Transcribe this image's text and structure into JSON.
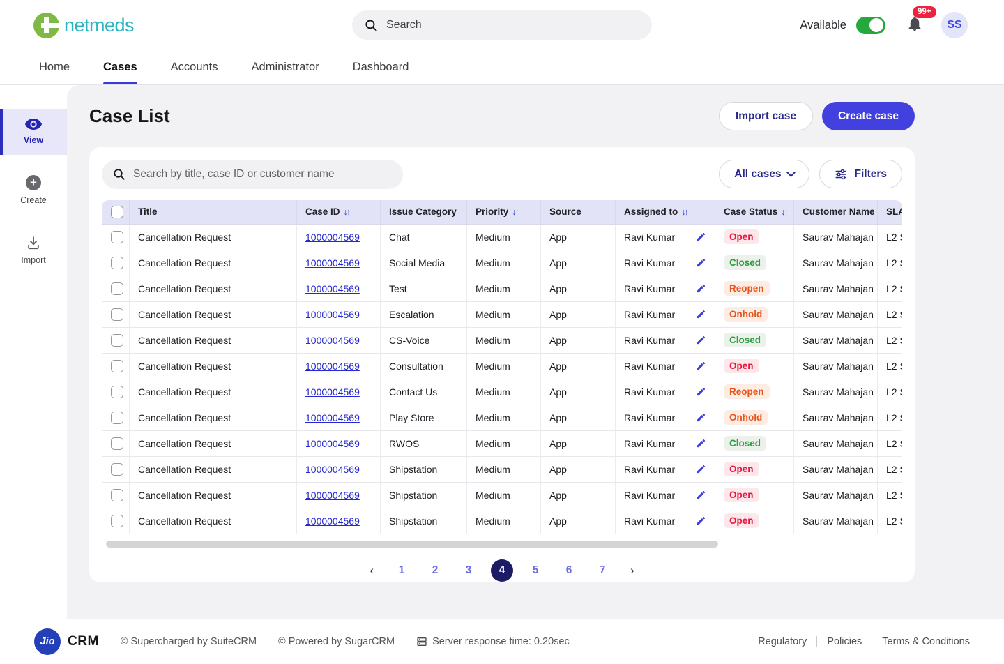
{
  "header": {
    "brand": "netmeds",
    "search_placeholder": "Search",
    "availability_label": "Available",
    "availability_on": true,
    "notification_count": "99+",
    "avatar_initials": "SS"
  },
  "nav": {
    "tabs": [
      {
        "label": "Home",
        "active": false
      },
      {
        "label": "Cases",
        "active": true
      },
      {
        "label": "Accounts",
        "active": false
      },
      {
        "label": "Administrator",
        "active": false
      },
      {
        "label": "Dashboard",
        "active": false
      }
    ]
  },
  "sidebar": {
    "items": [
      {
        "label": "View",
        "active": true
      },
      {
        "label": "Create",
        "active": false
      },
      {
        "label": "Import",
        "active": false
      }
    ]
  },
  "main": {
    "title": "Case List",
    "import_button": "Import case",
    "create_button": "Create case",
    "search_placeholder": "Search by title, case ID or customer name",
    "all_cases_button": "All cases",
    "filters_button": "Filters"
  },
  "table": {
    "columns": [
      {
        "label": "Title",
        "sortable": false
      },
      {
        "label": "Case ID",
        "sortable": true
      },
      {
        "label": "Issue Category",
        "sortable": false
      },
      {
        "label": "Priority",
        "sortable": true
      },
      {
        "label": "Source",
        "sortable": false
      },
      {
        "label": "Assigned to",
        "sortable": true
      },
      {
        "label": "Case Status",
        "sortable": true
      },
      {
        "label": "Customer Name",
        "sortable": false
      },
      {
        "label": "SLA",
        "sortable": false
      }
    ],
    "rows": [
      {
        "title": "Cancellation Request",
        "case_id": "1000004569",
        "issue_category": "Chat",
        "priority": "Medium",
        "source": "App",
        "assigned_to": "Ravi Kumar",
        "status": "Open",
        "customer": "Saurav Mahajan",
        "sla": "L2 S"
      },
      {
        "title": "Cancellation Request",
        "case_id": "1000004569",
        "issue_category": "Social Media",
        "priority": "Medium",
        "source": "App",
        "assigned_to": "Ravi Kumar",
        "status": "Closed",
        "customer": "Saurav Mahajan",
        "sla": "L2 S"
      },
      {
        "title": "Cancellation Request",
        "case_id": "1000004569",
        "issue_category": "Test",
        "priority": "Medium",
        "source": "App",
        "assigned_to": "Ravi Kumar",
        "status": "Reopen",
        "customer": "Saurav Mahajan",
        "sla": "L2 S"
      },
      {
        "title": "Cancellation Request",
        "case_id": "1000004569",
        "issue_category": "Escalation",
        "priority": "Medium",
        "source": "App",
        "assigned_to": "Ravi Kumar",
        "status": "Onhold",
        "customer": "Saurav Mahajan",
        "sla": "L2 S"
      },
      {
        "title": "Cancellation Request",
        "case_id": "1000004569",
        "issue_category": "CS-Voice",
        "priority": "Medium",
        "source": "App",
        "assigned_to": "Ravi Kumar",
        "status": "Closed",
        "customer": "Saurav Mahajan",
        "sla": "L2 S"
      },
      {
        "title": "Cancellation Request",
        "case_id": "1000004569",
        "issue_category": "Consultation",
        "priority": "Medium",
        "source": "App",
        "assigned_to": "Ravi Kumar",
        "status": "Open",
        "customer": "Saurav Mahajan",
        "sla": "L2 S"
      },
      {
        "title": "Cancellation Request",
        "case_id": "1000004569",
        "issue_category": "Contact Us",
        "priority": "Medium",
        "source": "App",
        "assigned_to": "Ravi Kumar",
        "status": "Reopen",
        "customer": "Saurav Mahajan",
        "sla": "L2 S"
      },
      {
        "title": "Cancellation Request",
        "case_id": "1000004569",
        "issue_category": "Play Store",
        "priority": "Medium",
        "source": "App",
        "assigned_to": "Ravi Kumar",
        "status": "Onhold",
        "customer": "Saurav Mahajan",
        "sla": "L2 S"
      },
      {
        "title": "Cancellation Request",
        "case_id": "1000004569",
        "issue_category": "RWOS",
        "priority": "Medium",
        "source": "App",
        "assigned_to": "Ravi Kumar",
        "status": "Closed",
        "customer": "Saurav Mahajan",
        "sla": "L2 S"
      },
      {
        "title": "Cancellation Request",
        "case_id": "1000004569",
        "issue_category": "Shipstation",
        "priority": "Medium",
        "source": "App",
        "assigned_to": "Ravi Kumar",
        "status": "Open",
        "customer": "Saurav Mahajan",
        "sla": "L2 S"
      },
      {
        "title": "Cancellation Request",
        "case_id": "1000004569",
        "issue_category": "Shipstation",
        "priority": "Medium",
        "source": "App",
        "assigned_to": "Ravi Kumar",
        "status": "Open",
        "customer": "Saurav Mahajan",
        "sla": "L2 S"
      },
      {
        "title": "Cancellation Request",
        "case_id": "1000004569",
        "issue_category": "Shipstation",
        "priority": "Medium",
        "source": "App",
        "assigned_to": "Ravi Kumar",
        "status": "Open",
        "customer": "Saurav Mahajan",
        "sla": "L2 S"
      }
    ]
  },
  "pagination": {
    "prev": "‹",
    "next": "›",
    "pages": [
      "1",
      "2",
      "3",
      "4",
      "5",
      "6",
      "7"
    ],
    "current": "4"
  },
  "footer": {
    "logo_text": "Jio",
    "brand": "CRM",
    "suite_text": "© Supercharged by SuiteCRM",
    "sugar_text": "© Powered by SugarCRM",
    "server_text": "Server response time: 0.20sec",
    "links": [
      "Regulatory",
      "Policies",
      "Terms & Conditions"
    ]
  },
  "colors": {
    "accent": "#4340e0",
    "navy": "#26268c",
    "link": "#2428d2",
    "status-open": "#e8173f",
    "status-closed": "#2f9e41",
    "status-warn": "#e5561f",
    "teal": "#2ab5c0",
    "leaf": "#7db944",
    "toggle-on": "#25a93c",
    "badge-red": "#ee2340",
    "jio-blue": "#2340b8"
  }
}
